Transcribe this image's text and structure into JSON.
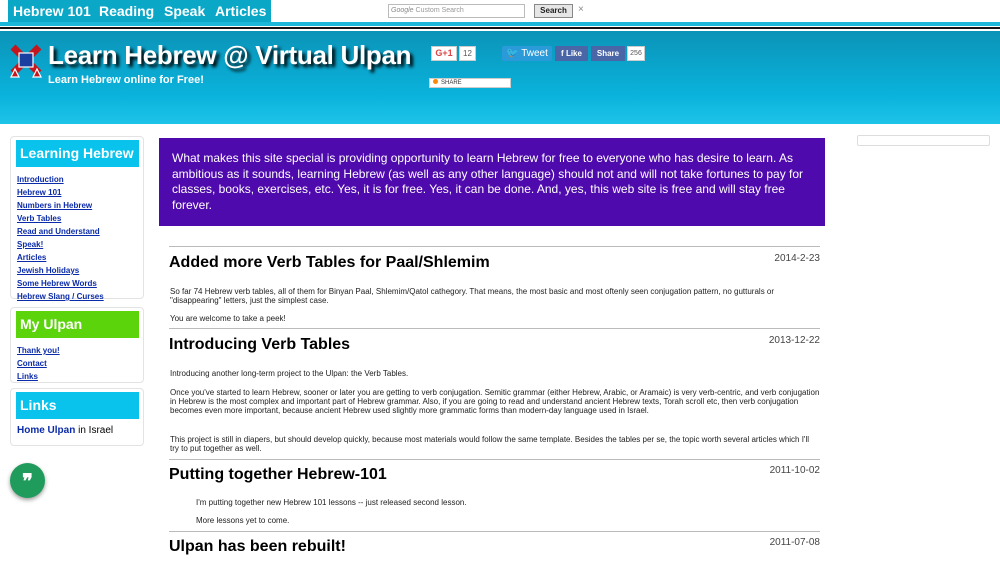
{
  "nav": {
    "tabs": [
      "Hebrew 101",
      "Reading",
      "Speak",
      "Articles"
    ],
    "search_placeholder": "Custom Search",
    "search_brand": "Google",
    "search_button": "Search",
    "clear": "×"
  },
  "header": {
    "title": "Learn Hebrew @ Virtual Ulpan",
    "subtitle": "Learn Hebrew online for Free!",
    "gplus_label": "G+1",
    "gplus_count": "12",
    "tweet_label": "Tweet",
    "fb_like": "Like",
    "fb_share": "Share",
    "fb_count": "256",
    "share_label": "SHARE"
  },
  "sidebar": {
    "learning": {
      "heading": "Learning Hebrew",
      "links": [
        "Introduction",
        "Hebrew 101",
        "Numbers in Hebrew",
        "Verb Tables",
        "Read and Understand",
        "Speak!",
        "Articles",
        "Jewish Holidays",
        "Some Hebrew Words",
        "Hebrew Slang / Curses"
      ]
    },
    "ulpan": {
      "heading": "My Ulpan",
      "links": [
        "Thank you!",
        "Contact",
        "Links"
      ]
    },
    "links": {
      "heading": "Links",
      "link_text": "Home Ulpan",
      "suffix": " in Israel"
    },
    "quote_icon": "❞"
  },
  "intro": "What makes this site special is providing opportunity to learn Hebrew for free to everyone who has desire to learn. As ambitious as it sounds, learning Hebrew (as well as any other language) should not and will not take fortunes to pay for classes, books, exercises, etc. Yes, it is for free. Yes, it can be done. And, yes, this web site is free and will stay free forever.",
  "posts": [
    {
      "title": "Added more Verb Tables for Paal/Shlemim",
      "date": "2014-2-23",
      "paragraphs": [
        "So far 74 Hebrew verb tables, all of them for Binyan Paal, Shlemim/Qatol cathegory. That means, the most basic and most oftenly seen conjugation pattern, no gutturals or \"disappearing\" letters, just the simplest case.",
        "You are welcome to take a peek!"
      ]
    },
    {
      "title": "Introducing Verb Tables",
      "date": "2013-12-22",
      "paragraphs": [
        "Introducing another long-term project to the Ulpan: the Verb Tables.",
        "Once you've started to learn Hebrew, sooner or later you are getting to verb conjugation. Semitic grammar (either Hebrew, Arabic, or Aramaic) is very verb-centric, and verb conjugation in Hebrew is the most complex and important part of Hebrew grammar. Also, if you are going to read and understand ancient Hebrew texts, Torah scroll etc, then verb conjugation becomes even more important, because ancient Hebrew used slightly more grammatic forms than modern-day language used in Israel.",
        "This project is still in diapers, but should develop quickly, because most materials would follow the same template. Besides the tables per se, the topic worth several articles which I'll try to put together as well."
      ]
    },
    {
      "title": "Putting together Hebrew-101",
      "date": "2011-10-02",
      "paragraphs": [
        "I'm putting together new Hebrew 101 lessons -- just released second lesson.",
        "More lessons yet to come."
      ]
    },
    {
      "title": "Ulpan has been rebuilt!",
      "date": "2011-07-08",
      "paragraphs": []
    }
  ],
  "colors": {
    "nav_tab": "#0aa7c7",
    "learning_head": "#0ac3ec",
    "ulpan_head": "#5cd40c",
    "links_head": "#0ac3ec",
    "intro_bg": "#4f0aad",
    "link": "#0b2ba8"
  }
}
